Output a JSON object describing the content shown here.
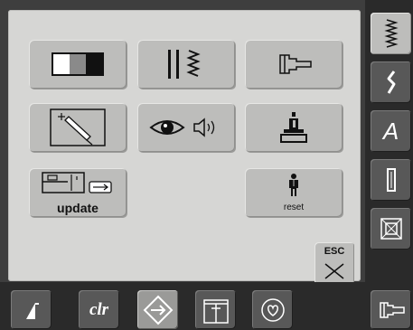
{
  "colors": {
    "panel": "#d6d6d4",
    "button": "#bdbdbb",
    "frame": "#2a2a2a",
    "dark_button": "#585858",
    "active_button": "#9a9a98"
  },
  "setup_menu": {
    "buttons": [
      {
        "icon": "screen-contrast-icon"
      },
      {
        "icon": "stitch-width-icon"
      },
      {
        "icon": "sewing-machine-foot-icon"
      },
      {
        "icon": "touchscreen-calibration-icon"
      },
      {
        "icon": "eye-and-sound-icon"
      },
      {
        "icon": "machine-info-icon"
      },
      {
        "icon": "machine-usb-icon",
        "label": "update"
      },
      {
        "icon": "person-icon",
        "label": "reset"
      }
    ],
    "esc_label": "ESC"
  },
  "right_bar": {
    "buttons": [
      {
        "icon": "zigzag-stitch-icon"
      },
      {
        "icon": "decorative-stitch-icon"
      },
      {
        "icon": "alphabet-icon",
        "label": "A"
      },
      {
        "icon": "buttonhole-icon"
      },
      {
        "icon": "quilt-icon"
      },
      {
        "icon": "presser-foot-icon"
      }
    ]
  },
  "bottom_bar": {
    "buttons": [
      {
        "icon": "needle-position-icon"
      },
      {
        "icon": "clear-icon",
        "label": "clr"
      },
      {
        "icon": "setup-icon",
        "active": true
      },
      {
        "icon": "tutorial-icon"
      },
      {
        "icon": "heart-icon"
      }
    ]
  }
}
